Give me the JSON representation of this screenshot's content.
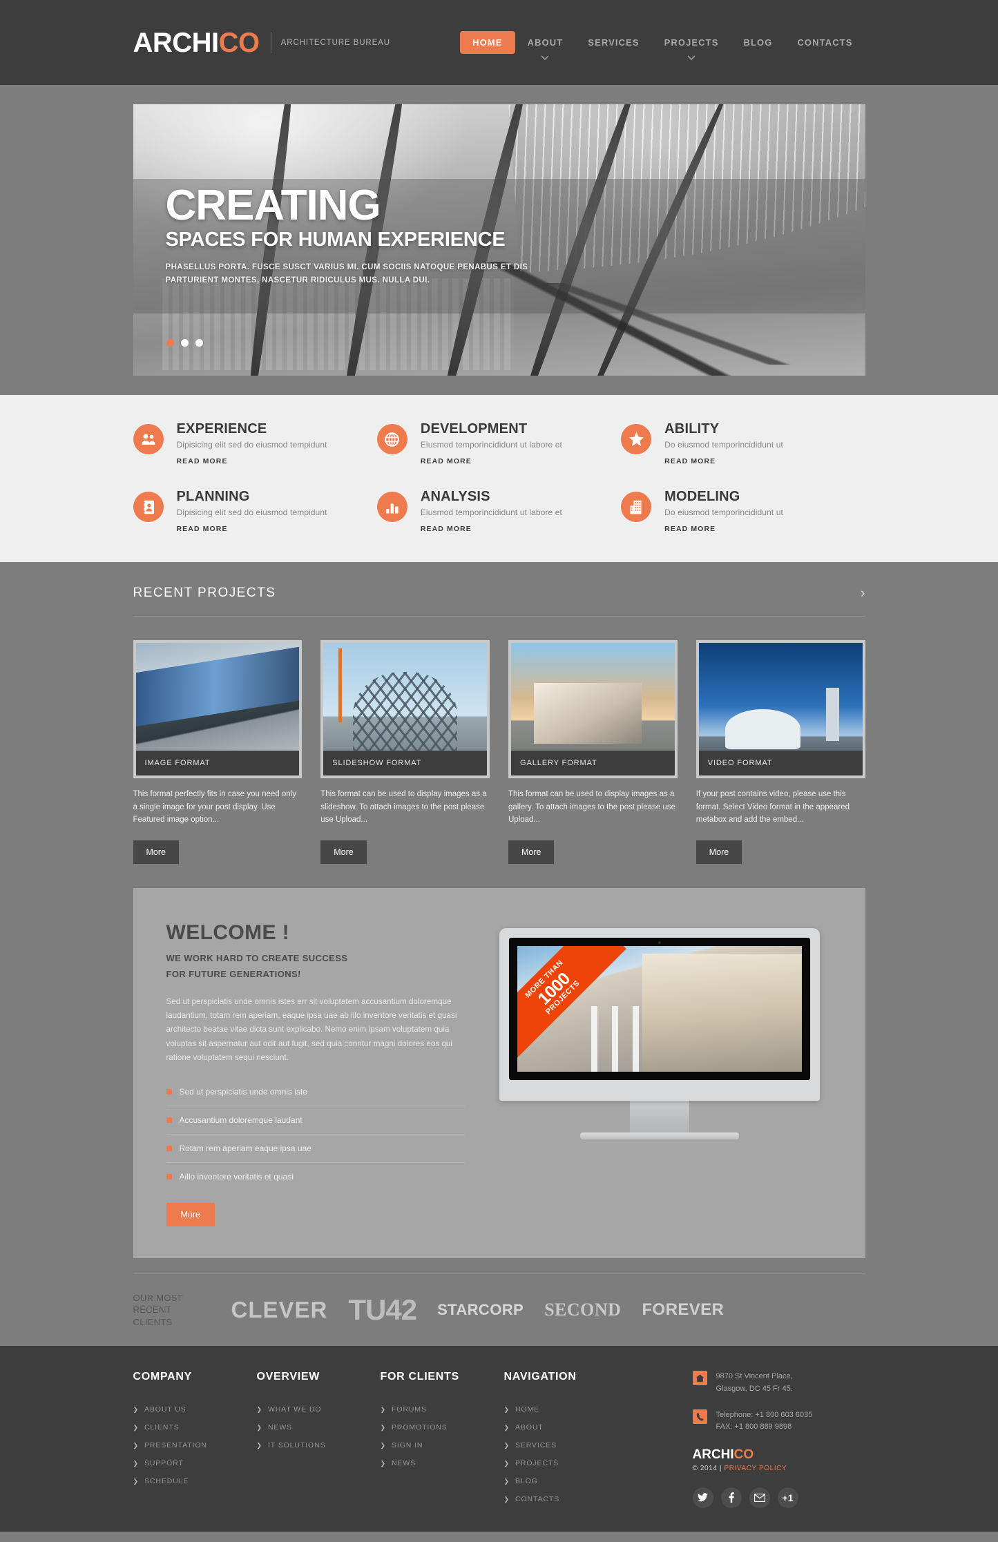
{
  "header": {
    "logo_primary": "ARCHI",
    "logo_accent": "CO",
    "tagline": "ARCHITECTURE BUREAU",
    "nav": [
      {
        "label": "HOME",
        "active": true,
        "caret": false
      },
      {
        "label": "ABOUT",
        "active": false,
        "caret": true
      },
      {
        "label": "SERVICES",
        "active": false,
        "caret": false
      },
      {
        "label": "PROJECTS",
        "active": false,
        "caret": true
      },
      {
        "label": "BLOG",
        "active": false,
        "caret": false
      },
      {
        "label": "CONTACTS",
        "active": false,
        "caret": false
      }
    ]
  },
  "hero": {
    "heading": "CREATING",
    "subheading": "SPACES FOR HUMAN EXPERIENCE",
    "paragraph": "PHASELLUS PORTA. FUSCE SUSCT VARIUS MI. CUM SOCIIS NATOQUE PENABUS ET DIS PARTURIENT MONTES, NASCETUR RIDICULUS MUS. NULLA DUI.",
    "slides": 3,
    "active_slide": 1
  },
  "services": [
    {
      "icon": "users-icon",
      "title": "EXPERIENCE",
      "desc": "Dipisicing elit sed do eiusmod tempidunt",
      "more": "READ MORE"
    },
    {
      "icon": "globe-icon",
      "title": "DEVELOPMENT",
      "desc": "Eiusmod temporincididunt ut labore et",
      "more": "READ MORE"
    },
    {
      "icon": "star-icon",
      "title": "ABILITY",
      "desc": "Do eiusmod temporincididunt ut",
      "more": "READ MORE"
    },
    {
      "icon": "contact-card-icon",
      "title": "PLANNING",
      "desc": "Dipisicing elit sed do eiusmod tempidunt",
      "more": "READ MORE"
    },
    {
      "icon": "bar-chart-icon",
      "title": "ANALYSIS",
      "desc": "Eiusmod temporincididunt ut labore et",
      "more": "READ MORE"
    },
    {
      "icon": "building-icon",
      "title": "MODELING",
      "desc": "Do eiusmod temporincididunt ut",
      "more": "READ MORE"
    }
  ],
  "projects": {
    "title": "RECENT PROJECTS",
    "arrow": "›",
    "cards": [
      {
        "caption": "IMAGE FORMAT",
        "desc": "This format perfectly fits in case you need only a single image for your post display. Use Featured image option...",
        "button": "More"
      },
      {
        "caption": "SLIDESHOW FORMAT",
        "desc": "This format can be used to display images as a slideshow. To attach images to the post please use Upload...",
        "button": "More"
      },
      {
        "caption": "GALLERY FORMAT",
        "desc": "This format can be used to display images as a gallery. To attach images to the post please use Upload...",
        "button": "More"
      },
      {
        "caption": "VIDEO FORMAT",
        "desc": "If your post contains video, please use this format. Select Video format in the appeared metabox and add the embed...",
        "button": "More"
      }
    ]
  },
  "welcome": {
    "heading": "WELCOME !",
    "subheading_line1": "WE WORK HARD TO CREATE SUCCESS",
    "subheading_line2": "FOR FUTURE GENERATIONS!",
    "body": "Sed ut perspiciatis unde omnis istes err sit voluptatem accusantium doloremque laudantium, totam rem aperiam, eaque ipsa uae ab illo inventore veritatis et quasi architecto beatae vitae dicta sunt explicabo. Nemo enim ipsam voluptatem quia voluptas sit aspernatur aut odit aut fugit, sed quia conntur magni dolores eos qui ratione voluptatem sequi nesciunt.",
    "list": [
      "Sed ut perspiciatis unde omnis iste",
      "Accusantium doloremque laudant",
      "Rotam rem aperiam eaque ipsa uae",
      "Aillo inventore veritatis et quasi"
    ],
    "button": "More",
    "ribbon_top": "MORE THAN",
    "ribbon_number": "1000",
    "ribbon_bottom": "PROJECTS"
  },
  "clients": {
    "label_line1": "OUR MOST",
    "label_line2": "RECENT CLIENTS",
    "logos": [
      "CLEVER",
      "TU42",
      "STARCORP",
      "SECOND",
      "FOREVER"
    ],
    "starcorp_bold": "STAR",
    "starcorp_light": "CORP"
  },
  "footer": {
    "columns": [
      {
        "heading": "COMPANY",
        "links": [
          "ABOUT US",
          "CLIENTS",
          "PRESENTATION",
          "SUPPORT",
          "SCHEDULE"
        ]
      },
      {
        "heading": "OVERVIEW",
        "links": [
          "WHAT WE DO",
          "NEWS",
          "IT SOLUTIONS"
        ]
      },
      {
        "heading": "FOR CLIENTS",
        "links": [
          "FORUMS",
          "PROMOTIONS",
          "SIGN IN",
          "NEWS"
        ]
      },
      {
        "heading": "NAVIGATION",
        "links": [
          "HOME",
          "ABOUT",
          "SERVICES",
          "PROJECTS",
          "BLOG",
          "CONTACTS"
        ]
      }
    ],
    "address_line1": "9870 St Vincent Place,",
    "address_line2": "Glasgow, DC 45 Fr 45.",
    "phone_line1": "Telephone: +1 800 603 6035",
    "phone_line2": "FAX: +1 800 889 9898",
    "logo_primary": "ARCHI",
    "logo_accent": "CO",
    "copyright": "© 2014 | ",
    "privacy": "PRIVACY POLICY",
    "social": [
      "twitter-icon",
      "facebook-icon",
      "mail-icon",
      "google-plus-icon"
    ],
    "google_plus_label": "+1"
  },
  "colors": {
    "accent": "#ee7b4d",
    "dark": "#3d3d3d",
    "mid_gray": "#7d7d7d",
    "light_gray": "#efefef",
    "ribbon": "#ef4407"
  }
}
